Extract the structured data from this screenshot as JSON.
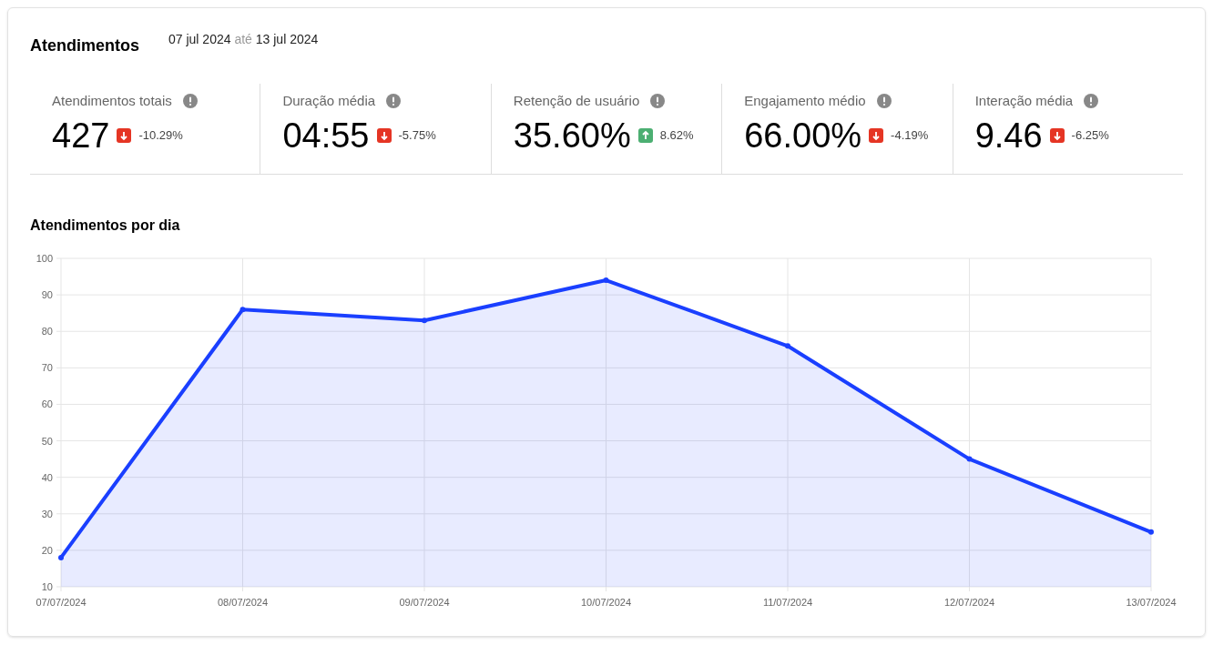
{
  "header": {
    "title": "Atendimentos",
    "date_start": "07 jul 2024",
    "date_separator": "até",
    "date_end": "13 jul 2024"
  },
  "metrics": [
    {
      "label": "Atendimentos totais",
      "value": "427",
      "kind": "down",
      "change": "-10.29%"
    },
    {
      "label": "Duração média",
      "value": "04:55",
      "kind": "down",
      "change": "-5.75%"
    },
    {
      "label": "Retenção de usuário",
      "value": "35.60%",
      "kind": "up",
      "change": "8.62%"
    },
    {
      "label": "Engajamento médio",
      "value": "66.00%",
      "kind": "down",
      "change": "-4.19%"
    },
    {
      "label": "Interação média",
      "value": "9.46",
      "kind": "down",
      "change": "-6.25%"
    }
  ],
  "chart": {
    "title": "Atendimentos por dia",
    "chart_data": {
      "type": "area",
      "categories": [
        "07/07/2024",
        "08/07/2024",
        "09/07/2024",
        "10/07/2024",
        "11/07/2024",
        "12/07/2024",
        "13/07/2024"
      ],
      "series": [
        {
          "color": "#1a3fff",
          "values": [
            18,
            86,
            83,
            94,
            76,
            45,
            25
          ]
        }
      ],
      "grid": true,
      "ylim": [
        10,
        100
      ],
      "yticks": [
        10,
        20,
        30,
        40,
        50,
        60,
        70,
        80,
        90,
        100
      ]
    }
  }
}
